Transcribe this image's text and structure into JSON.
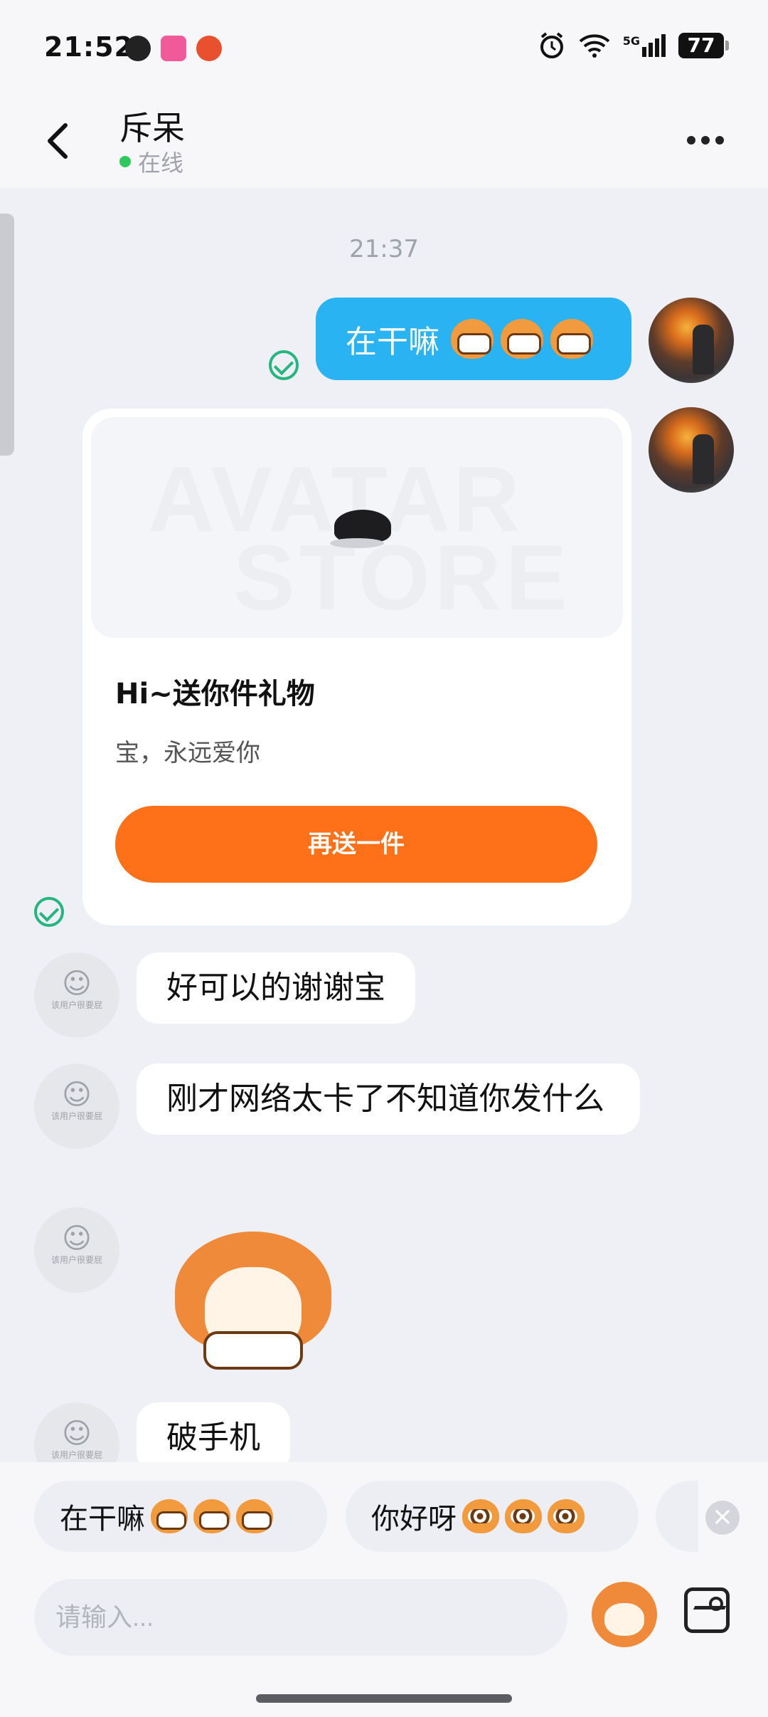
{
  "status_bar": {
    "time": "21:52",
    "network": "5G",
    "battery": "77"
  },
  "header": {
    "title": "斥呆",
    "status": "在线"
  },
  "messages": {
    "timestamp": "21:37",
    "sent_text": "在干嘛",
    "gift": {
      "watermark_line1": "AVATAR",
      "watermark_line2": "STORE",
      "title": "Hi~送你件礼物",
      "subtitle": "宝，永远爱你",
      "button": "再送一件"
    },
    "received": [
      "好可以的谢谢宝",
      "刚才网络太卡了不知道你发什么",
      "破手机"
    ],
    "avatar_caption": "该用户很要屁"
  },
  "quick_replies": [
    {
      "text": "在干嘛"
    },
    {
      "text": "你好呀"
    }
  ],
  "input": {
    "placeholder": "请输入..."
  },
  "icons": {
    "back": "chevron-left-icon",
    "more": "more-dots-icon",
    "check": "check-circle-icon",
    "close": "close-icon",
    "sticker": "sticker-icon",
    "image": "image-icon"
  },
  "colors": {
    "sent_bubble": "#29b3f3",
    "gift_button": "#ff7119",
    "check": "#26b57e",
    "online_dot": "#2fc85a"
  }
}
